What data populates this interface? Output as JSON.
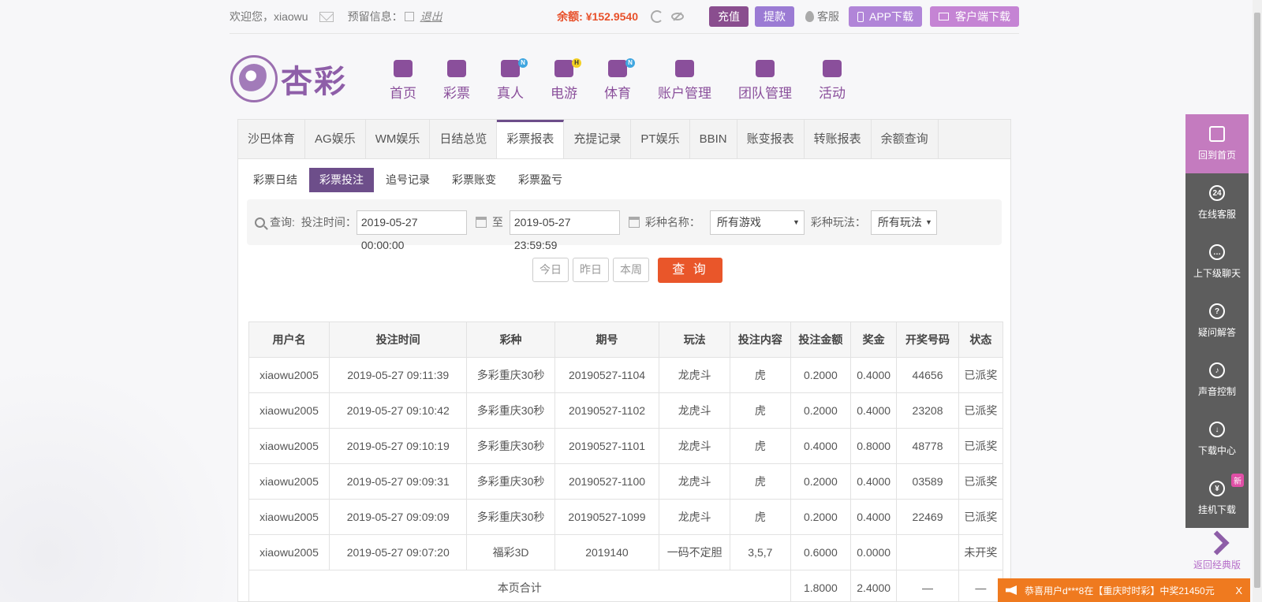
{
  "topbar": {
    "welcome": "欢迎您，",
    "username": "xiaowu",
    "reserve_label": "预留信息：",
    "logout": "退出",
    "balance_label": "余额:",
    "balance_value": "¥152.9540",
    "recharge": "充值",
    "withdraw": "提款",
    "service": "客服",
    "app_download": "APP下载",
    "client_download": "客户端下载"
  },
  "logo": {
    "text": "杏彩"
  },
  "nav": [
    {
      "label": "首页",
      "icon": "home-icon",
      "badge": ""
    },
    {
      "label": "彩票",
      "icon": "ticket-icon",
      "badge": ""
    },
    {
      "label": "真人",
      "icon": "dealer-icon",
      "badge": "N"
    },
    {
      "label": "电游",
      "icon": "gamepad-icon",
      "badge": "H"
    },
    {
      "label": "体育",
      "icon": "trophy-icon",
      "badge": "N"
    },
    {
      "label": "账户管理",
      "icon": "account-icon",
      "badge": ""
    },
    {
      "label": "团队管理",
      "icon": "team-icon",
      "badge": ""
    },
    {
      "label": "活动",
      "icon": "gift-icon",
      "badge": ""
    }
  ],
  "tabs": [
    "沙巴体育",
    "AG娱乐",
    "WM娱乐",
    "日结总览",
    "彩票报表",
    "充提记录",
    "PT娱乐",
    "BBIN",
    "账变报表",
    "转账报表",
    "余额查询"
  ],
  "active_tab": 4,
  "subtabs": [
    "彩票日结",
    "彩票投注",
    "追号记录",
    "彩票账变",
    "彩票盈亏"
  ],
  "active_subtab": 1,
  "search": {
    "query_label": "查询:",
    "bet_time_label": "投注时间：",
    "start_time": "2019-05-27 00:00:00",
    "to_label": "至",
    "end_time": "2019-05-27 23:59:59",
    "game_name_label": "彩种名称：",
    "game_name_value": "所有游戏",
    "play_label": "彩种玩法：",
    "play_value": "所有玩法"
  },
  "quick": {
    "today": "今日",
    "yesterday": "昨日",
    "week": "本周",
    "query": "查 询"
  },
  "table": {
    "headers": [
      "用户名",
      "投注时间",
      "彩种",
      "期号",
      "玩法",
      "投注内容",
      "投注金额",
      "奖金",
      "开奖号码",
      "状态"
    ],
    "rows": [
      [
        "xiaowu2005",
        "2019-05-27 09:11:39",
        "多彩重庆30秒",
        "20190527-1104",
        "龙虎斗",
        "虎",
        "0.2000",
        "0.4000",
        "44656",
        "已派奖"
      ],
      [
        "xiaowu2005",
        "2019-05-27 09:10:42",
        "多彩重庆30秒",
        "20190527-1102",
        "龙虎斗",
        "虎",
        "0.2000",
        "0.4000",
        "23208",
        "已派奖"
      ],
      [
        "xiaowu2005",
        "2019-05-27 09:10:19",
        "多彩重庆30秒",
        "20190527-1101",
        "龙虎斗",
        "虎",
        "0.4000",
        "0.8000",
        "48778",
        "已派奖"
      ],
      [
        "xiaowu2005",
        "2019-05-27 09:09:31",
        "多彩重庆30秒",
        "20190527-1100",
        "龙虎斗",
        "虎",
        "0.2000",
        "0.4000",
        "03589",
        "已派奖"
      ],
      [
        "xiaowu2005",
        "2019-05-27 09:09:09",
        "多彩重庆30秒",
        "20190527-1099",
        "龙虎斗",
        "虎",
        "0.2000",
        "0.4000",
        "22469",
        "已派奖"
      ],
      [
        "xiaowu2005",
        "2019-05-27 09:07:20",
        "福彩3D",
        "2019140",
        "一码不定胆",
        "3,5,7",
        "0.6000",
        "0.0000",
        "",
        "未开奖"
      ]
    ],
    "total_label": "本页合计",
    "total_amount": "1.8000",
    "total_prize": "2.4000",
    "total_dash1": "—",
    "total_dash2": "—"
  },
  "sidebar": [
    {
      "label": "回到首页",
      "icon": "home-icon",
      "glyph": ""
    },
    {
      "label": "在线客服",
      "icon": "support-24-icon",
      "glyph": "24"
    },
    {
      "label": "上下级聊天",
      "icon": "chat-icon",
      "glyph": "…"
    },
    {
      "label": "疑问解答",
      "icon": "question-icon",
      "glyph": "?"
    },
    {
      "label": "声音控制",
      "icon": "speaker-icon",
      "glyph": "♪"
    },
    {
      "label": "下载中心",
      "icon": "cloud-download-icon",
      "glyph": "↓"
    },
    {
      "label": "挂机下载",
      "icon": "moneybag-icon",
      "glyph": "¥",
      "badge": "新"
    }
  ],
  "sidebar_return": "返回经典版",
  "notice": {
    "text": "恭喜用户d***8在【重庆时时彩】中奖21450元",
    "close": "X"
  },
  "colors": {
    "brand": "#6d4e8a",
    "accent": "#e9562a",
    "paid": "#e8502a",
    "open": "#3a9a3a"
  }
}
